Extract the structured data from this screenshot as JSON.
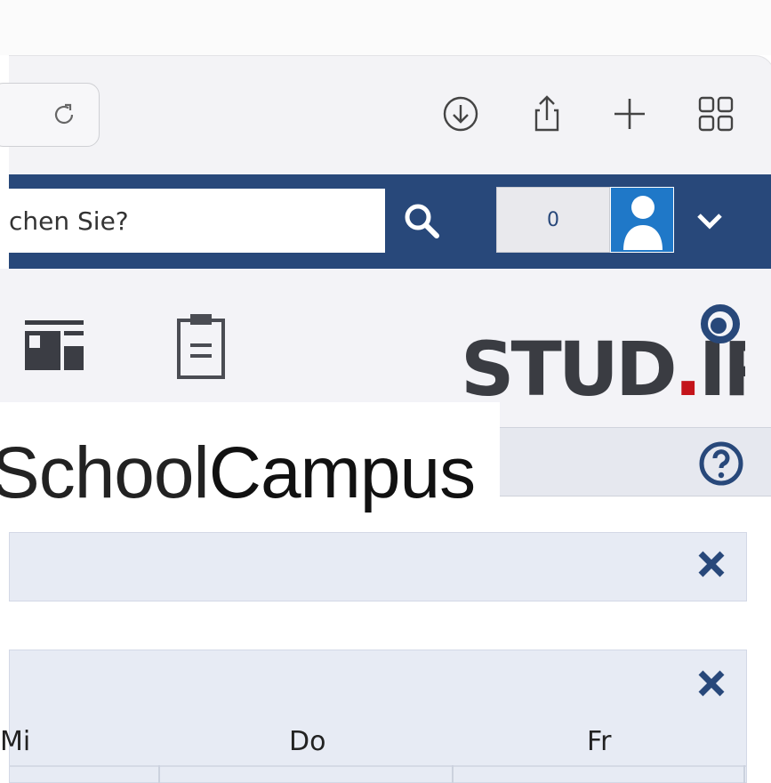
{
  "browser": {
    "icons": [
      "reload-icon",
      "download-icon",
      "share-icon",
      "new-tab-icon",
      "tab-overview-icon"
    ]
  },
  "header": {
    "search_value": "chen Sie?",
    "notification_count": "0",
    "colors": {
      "nav_bg": "#28487a",
      "accent_red": "#c4141b"
    }
  },
  "tools": {
    "icons": [
      "dashboard-icon",
      "clipboard-icon"
    ],
    "logo": {
      "text_main": "STUD",
      "dot": ".",
      "text_end": "IP"
    }
  },
  "overlay": {
    "light": "School",
    "bold": "Campus"
  },
  "widgets": [
    {
      "close_label": "✖"
    },
    {
      "close_label": "✖"
    }
  ],
  "schedule": {
    "days": [
      "Mi",
      "Do",
      "Fr"
    ]
  }
}
